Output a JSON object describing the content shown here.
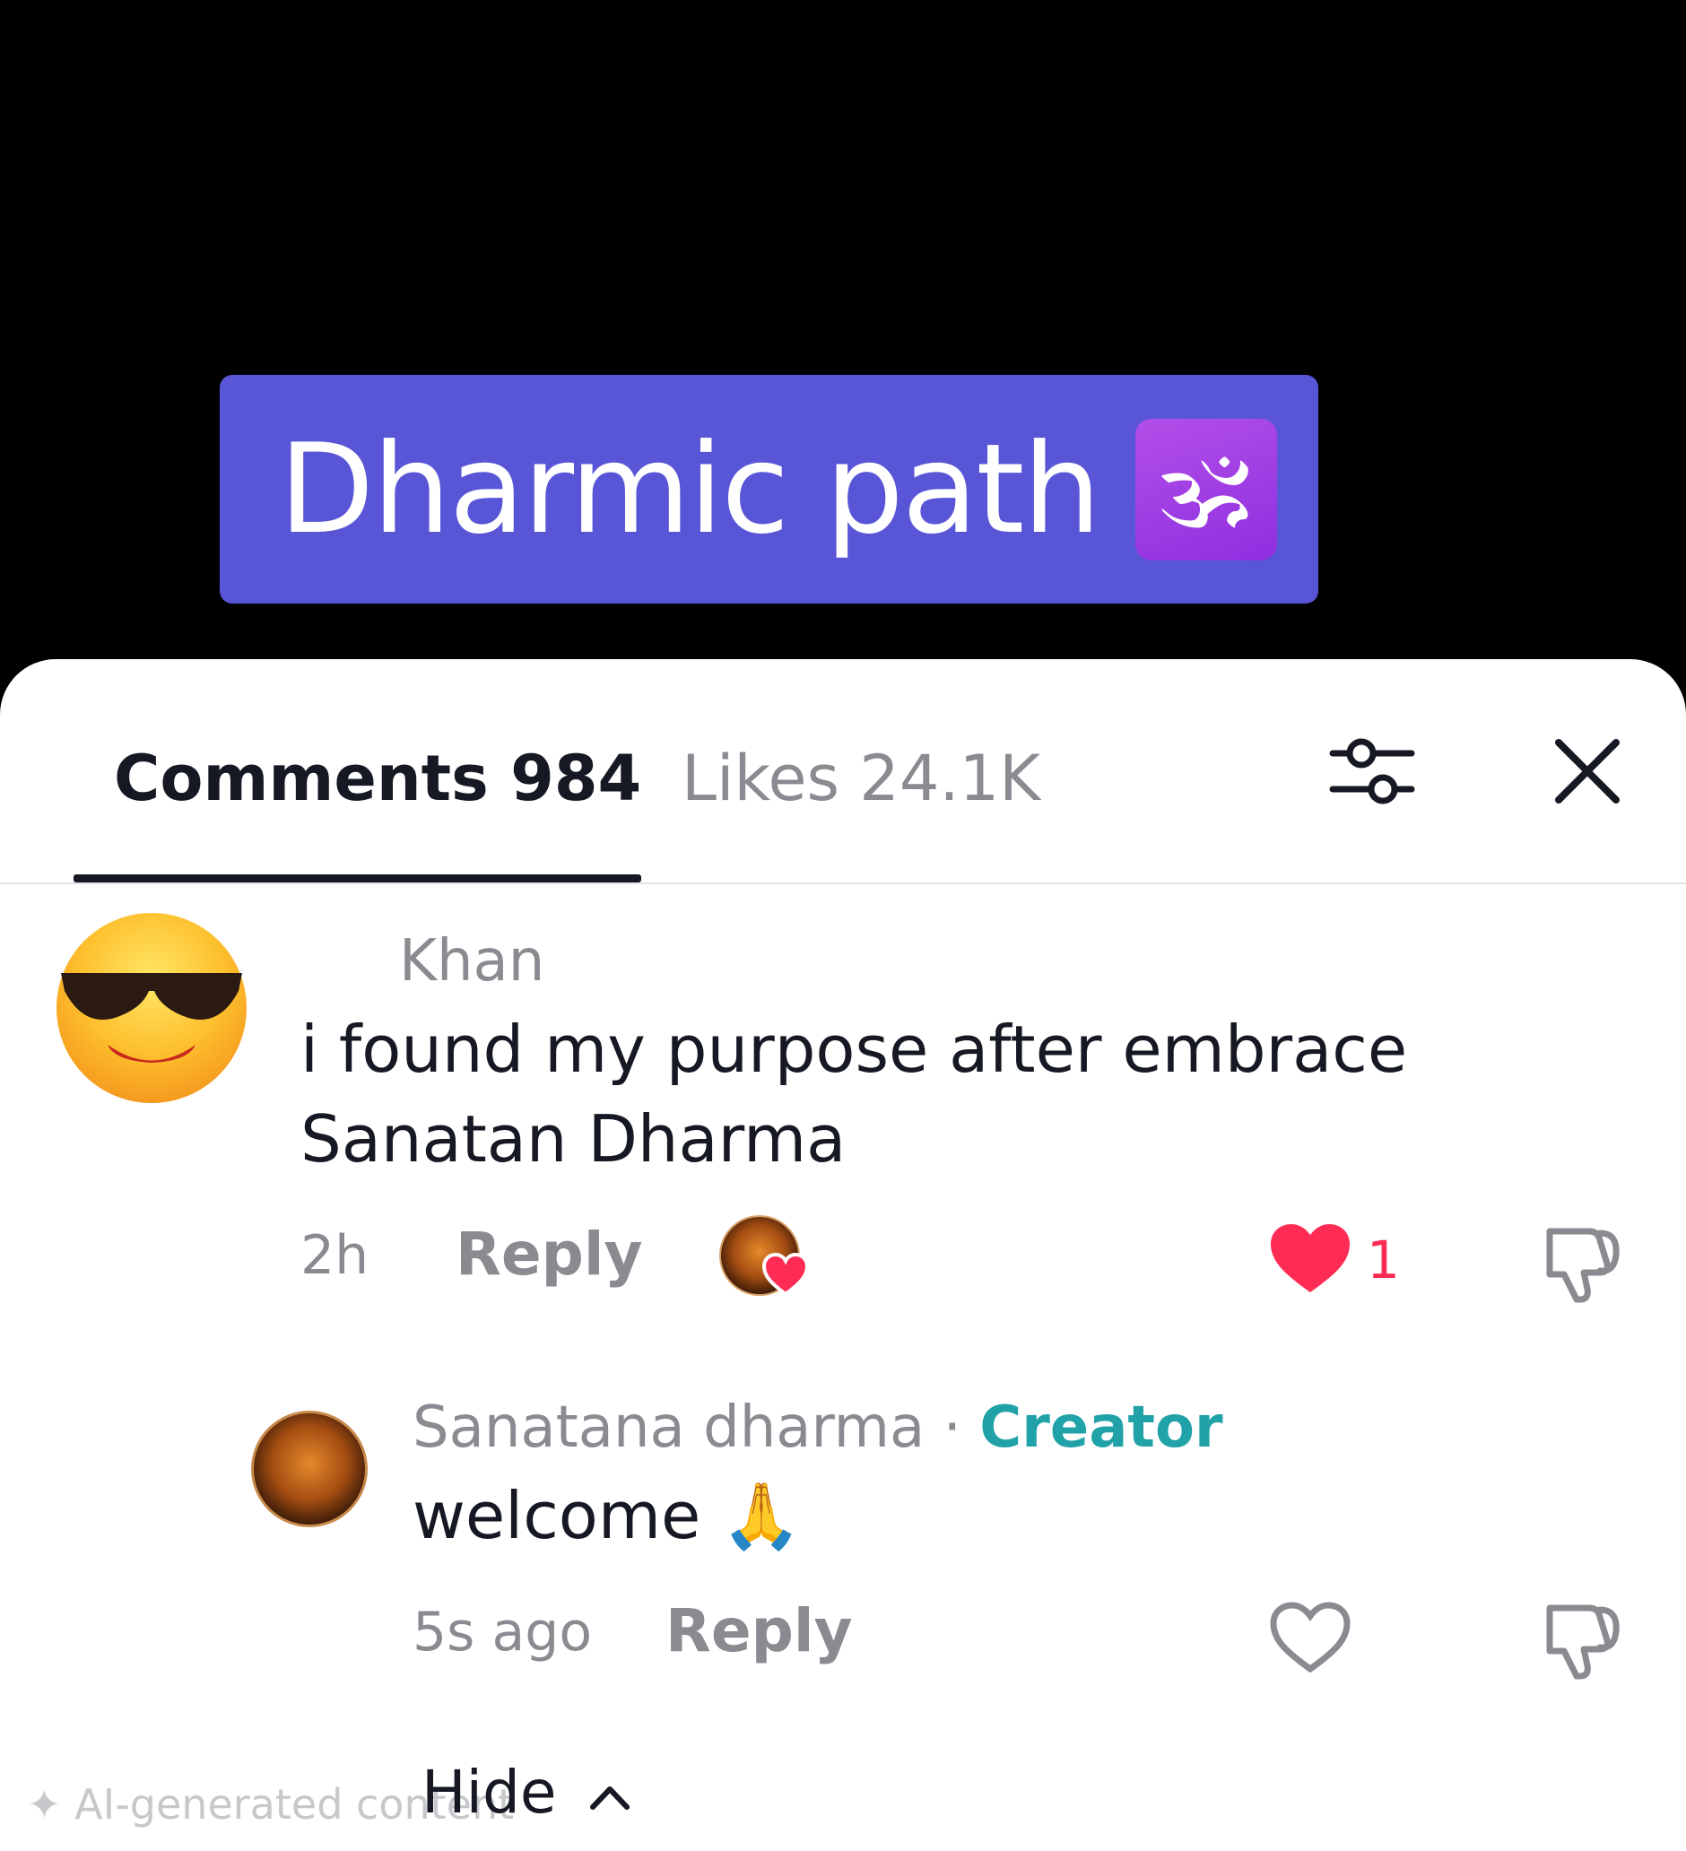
{
  "video": {
    "title": "Dharmic path",
    "title_emoji": "🕉"
  },
  "tabs": {
    "comments_label": "Comments 984",
    "likes_label": "Likes 24.1K"
  },
  "comments": [
    {
      "username": "Khan",
      "text_line1": "i found my purpose after embrace",
      "text_line2": "Sanatan Dharma",
      "time": "2h",
      "reply_label": "Reply",
      "like_count": "1",
      "liked_by_creator": true,
      "liked": true
    }
  ],
  "reply": {
    "username": "Sanatana dharma",
    "separator": " · ",
    "badge": "Creator",
    "text": "welcome 🙏",
    "time": "5s ago",
    "reply_label": "Reply",
    "liked": false
  },
  "footer": {
    "hide_label": "Hide",
    "ai_label": "AI-generated content"
  },
  "colors": {
    "banner": "#5856d6",
    "like_red": "#fe2c55",
    "creator_teal": "#20a2a8"
  }
}
